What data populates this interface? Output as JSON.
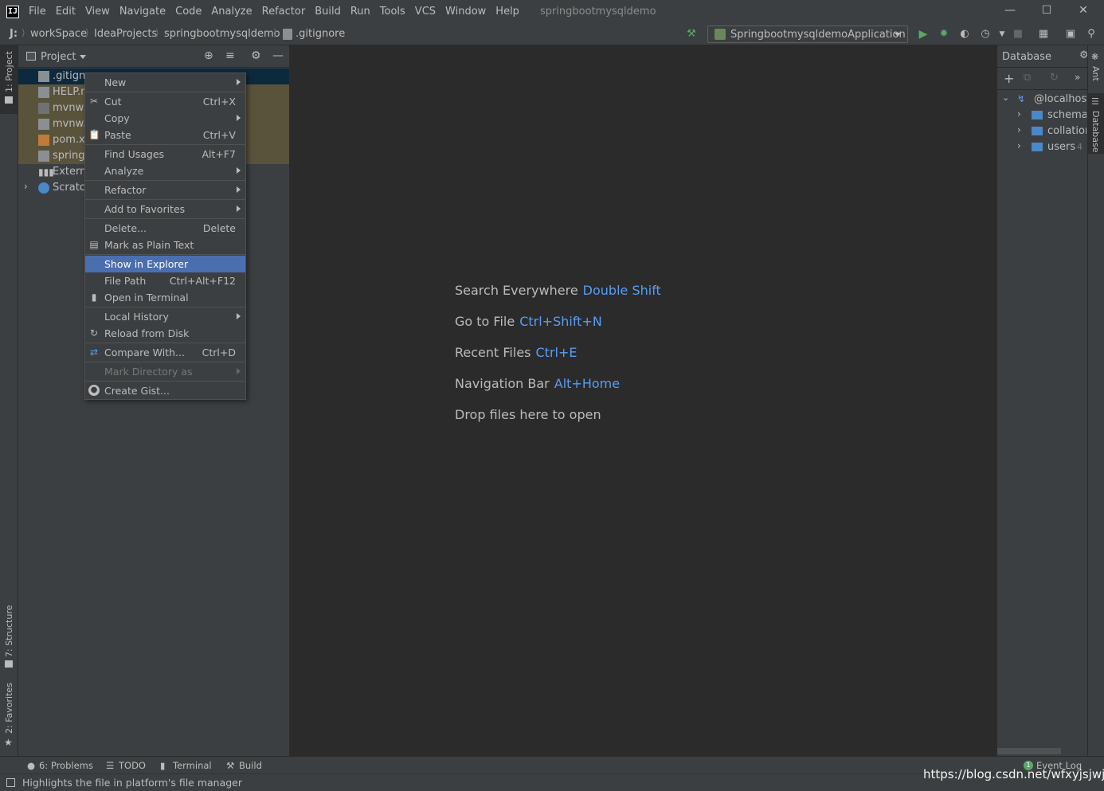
{
  "menubar": {
    "logo_letter": "IJ",
    "items": [
      "File",
      "Edit",
      "View",
      "Navigate",
      "Code",
      "Analyze",
      "Refactor",
      "Build",
      "Run",
      "Tools",
      "VCS",
      "Window",
      "Help"
    ],
    "window_title": "springbootmysqldemo"
  },
  "navbar": {
    "drive": "J:",
    "breadcrumbs": [
      "workSpace",
      "IdeaProjects",
      "springbootmysqldemo",
      ".gitignore"
    ],
    "run_config": "SpringbootmysqldemoApplication"
  },
  "left_stripe": {
    "project_tab": "1: Project",
    "structure_tab": "7: Structure",
    "favorites_tab": "2: Favorites"
  },
  "project_panel": {
    "title": "Project",
    "rows": [
      {
        "label": ".gitignore",
        "selected": true
      },
      {
        "label": "HELP.md",
        "highlighted": true
      },
      {
        "label": "mvnw",
        "highlighted": true
      },
      {
        "label": "mvnw.cmd",
        "highlighted": true
      },
      {
        "label": "pom.xml",
        "highlighted": true
      },
      {
        "label": "springbootmysqldemo.iml",
        "highlighted": true
      },
      {
        "label": "External Libraries",
        "highlighted": false
      },
      {
        "label": "Scratches and Consoles",
        "highlighted": false
      }
    ]
  },
  "context_menu": {
    "items": [
      {
        "label": "New",
        "shortcut": "",
        "submenu": true
      },
      {
        "label": "Cut",
        "shortcut": "Ctrl+X",
        "icon": "scissors-icon"
      },
      {
        "label": "Copy",
        "shortcut": "",
        "submenu": true
      },
      {
        "label": "Paste",
        "shortcut": "Ctrl+V",
        "icon": "clipboard-icon"
      },
      {
        "label": "Find Usages",
        "shortcut": "Alt+F7"
      },
      {
        "label": "Analyze",
        "shortcut": "",
        "submenu": true
      },
      {
        "label": "Refactor",
        "shortcut": "",
        "submenu": true
      },
      {
        "label": "Add to Favorites",
        "shortcut": "",
        "submenu": true
      },
      {
        "label": "Delete...",
        "shortcut": "Delete"
      },
      {
        "label": "Mark as Plain Text",
        "shortcut": "",
        "icon": "plain-text-icon"
      },
      {
        "label": "Show in Explorer",
        "shortcut": "",
        "selected": true
      },
      {
        "label": "File Path",
        "shortcut": "Ctrl+Alt+F12"
      },
      {
        "label": "Open in Terminal",
        "shortcut": "",
        "icon": "terminal-icon"
      },
      {
        "label": "Local History",
        "shortcut": "",
        "submenu": true
      },
      {
        "label": "Reload from Disk",
        "shortcut": "",
        "icon": "reload-icon"
      },
      {
        "label": "Compare With...",
        "shortcut": "Ctrl+D",
        "icon": "compare-icon"
      },
      {
        "label": "Mark Directory as",
        "shortcut": "",
        "submenu": true,
        "disabled": true
      },
      {
        "label": "Create Gist...",
        "shortcut": "",
        "icon": "github-icon"
      }
    ]
  },
  "editor": {
    "hints": [
      {
        "label": "Search Everywhere",
        "key": "Double Shift"
      },
      {
        "label": "Go to File",
        "key": "Ctrl+Shift+N"
      },
      {
        "label": "Recent Files",
        "key": "Ctrl+E"
      },
      {
        "label": "Navigation Bar",
        "key": "Alt+Home"
      },
      {
        "label": "Drop files here to open",
        "key": ""
      }
    ]
  },
  "database_panel": {
    "title": "Database",
    "tree": [
      {
        "label": "@localhost"
      },
      {
        "label": "schemas"
      },
      {
        "label": "collations"
      },
      {
        "label": "users",
        "count": "4"
      }
    ]
  },
  "right_stripe": {
    "ant_tab": "Ant",
    "database_tab": "Database"
  },
  "bottom_tabs": {
    "problems": "6: Problems",
    "todo": "TODO",
    "terminal": "Terminal",
    "build": "Build",
    "event_log": "Event Log",
    "event_count": "1"
  },
  "statusbar": {
    "text": "Highlights the file in platform's file manager"
  },
  "watermark": "https://blog.csdn.net/wfxyjsjwjs",
  "colors": {
    "background": "#3c3f41",
    "editor": "#2b2b2b",
    "selection": "#4b6eaf",
    "accent_blue": "#589df6",
    "modified_row": "#5a533c"
  }
}
